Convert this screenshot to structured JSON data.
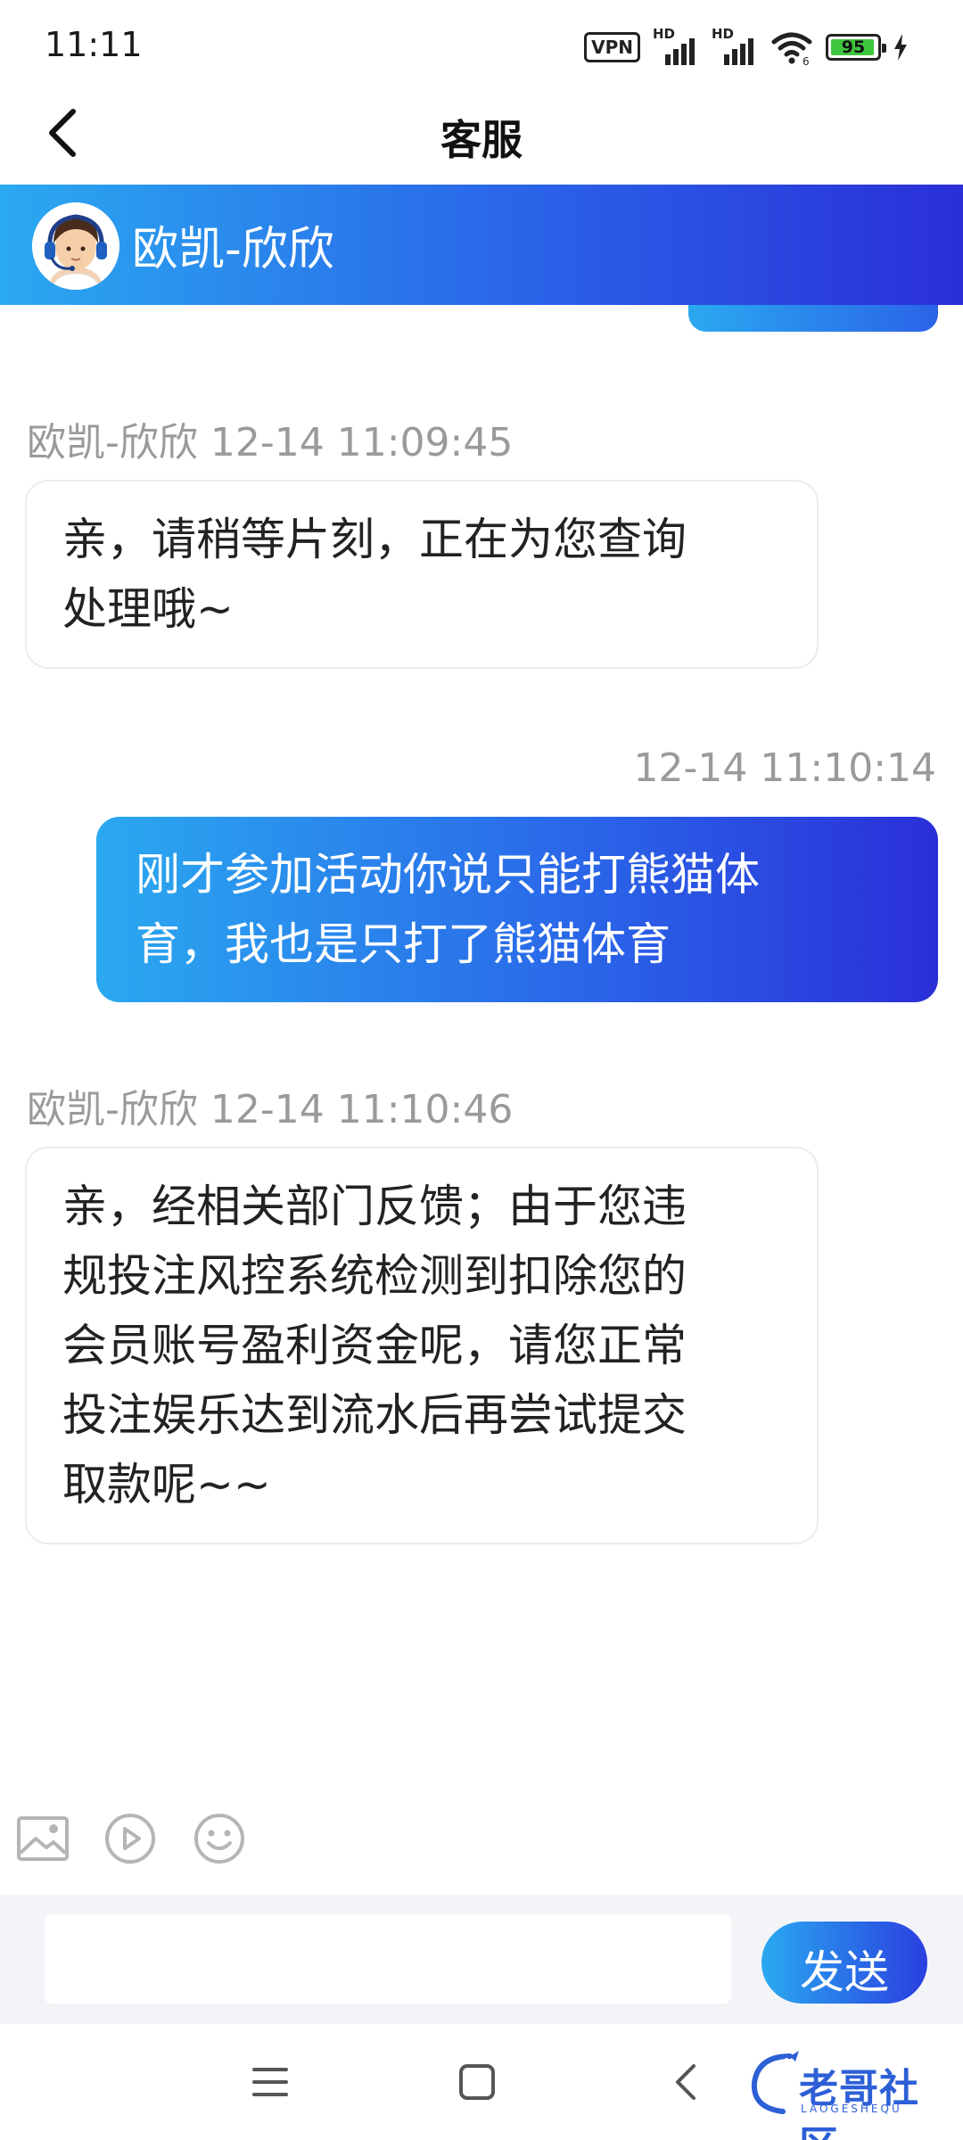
{
  "status_bar": {
    "time": "11:11",
    "vpn_label": "VPN",
    "hd_label_1": "HD",
    "hd_label_2": "HD",
    "battery_level": "95",
    "battery_fraction": 0.95,
    "accent_battery": "#3ec63e"
  },
  "header": {
    "title": "客服",
    "back_icon": "chevron-left-icon"
  },
  "agent": {
    "name": "欧凯-欣欣",
    "avatar_icon": "support-agent-avatar"
  },
  "messages": [
    {
      "side": "left",
      "meta": "欧凯-欣欣 12-14 11:09:45",
      "lines": [
        "亲，请稍等片刻，正在为您查询",
        "处理哦~"
      ]
    },
    {
      "side": "right",
      "meta": "12-14 11:10:14",
      "lines": [
        "刚才参加活动你说只能打熊猫体",
        "育，我也是只打了熊猫体育"
      ]
    },
    {
      "side": "left",
      "meta": "欧凯-欣欣 12-14 11:10:46",
      "lines": [
        "亲，经相关部门反馈；由于您违",
        "规投注风控系统检测到扣除您的",
        "会员账号盈利资金呢，请您正常",
        "投注娱乐达到流水后再尝试提交",
        "取款呢~~"
      ]
    }
  ],
  "toolbar": {
    "icons": [
      "image-icon",
      "video-icon",
      "emoji-icon"
    ]
  },
  "composer": {
    "input_value": "",
    "input_placeholder": "",
    "send_label": "发送"
  },
  "nav": {
    "icons": [
      "menu-icon",
      "home-square-icon",
      "back-arrow-icon"
    ]
  },
  "watermark": {
    "text": "老哥社区",
    "sub": "LAOGESHEQU"
  },
  "colors": {
    "brand_gradient_start": "#2aa9f0",
    "brand_gradient_end": "#2a2fd8",
    "meta_text": "#9a9a9a"
  }
}
